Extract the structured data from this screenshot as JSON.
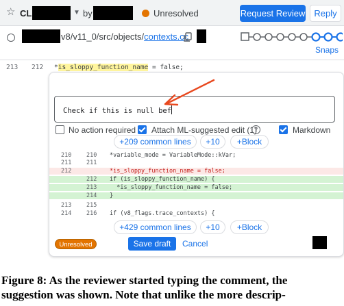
{
  "header": {
    "cl_label": "CL",
    "by_label": "by",
    "status_label": "Unresolved",
    "request_review_label": "Request Review",
    "reply_label": "Reply",
    "status_color": "#e37400",
    "accent_color": "#1a73e8"
  },
  "file": {
    "path_prefix": "v8/v11_0/src/objects/",
    "path_link": "contexts.cc",
    "snaps_label": "Snaps"
  },
  "code": {
    "line_left": "213",
    "line_right": "212",
    "pre": "*",
    "highlight": "is_sloppy_function_name",
    "post": " = false;"
  },
  "comment": {
    "typed_text": "Check if this is null bef",
    "no_action_label": "No action required",
    "attach_label": "Attach ML-suggested edit (1)",
    "markdown_label": "Markdown",
    "no_action_checked": false,
    "attach_checked": true,
    "markdown_checked": true
  },
  "suggestion": {
    "top_common": "+209 common lines",
    "top_plus10": "+10",
    "top_block": "+Block",
    "bottom_common": "+429 common lines",
    "bottom_plus10": "+10",
    "bottom_block": "+Block",
    "rows": [
      {
        "l": "210",
        "r": "210",
        "t": "*variable_mode = VariableMode::kVar;",
        "kind": "ctx"
      },
      {
        "l": "211",
        "r": "211",
        "t": "",
        "kind": "ctx"
      },
      {
        "l": "212",
        "r": "",
        "t": "*is_sloppy_function_name = false;",
        "kind": "del"
      },
      {
        "l": "",
        "r": "212",
        "t": "if (is_sloppy_function_name) {",
        "kind": "add"
      },
      {
        "l": "",
        "r": "213",
        "t": "  *is_sloppy_function_name = false;",
        "kind": "add"
      },
      {
        "l": "",
        "r": "214",
        "t": "}",
        "kind": "add"
      },
      {
        "l": "213",
        "r": "215",
        "t": "",
        "kind": "ctx"
      },
      {
        "l": "214",
        "r": "216",
        "t": "if (v8_flags.trace_contexts) {",
        "kind": "ctx"
      }
    ]
  },
  "footer": {
    "badge_label": "Unresolved",
    "save_draft_label": "Save draft",
    "cancel_label": "Cancel"
  },
  "caption": {
    "line1": "Figure 8: As the reviewer started typing the comment, the",
    "line2": "suggestion was shown. Note that unlike the more descrip-"
  }
}
